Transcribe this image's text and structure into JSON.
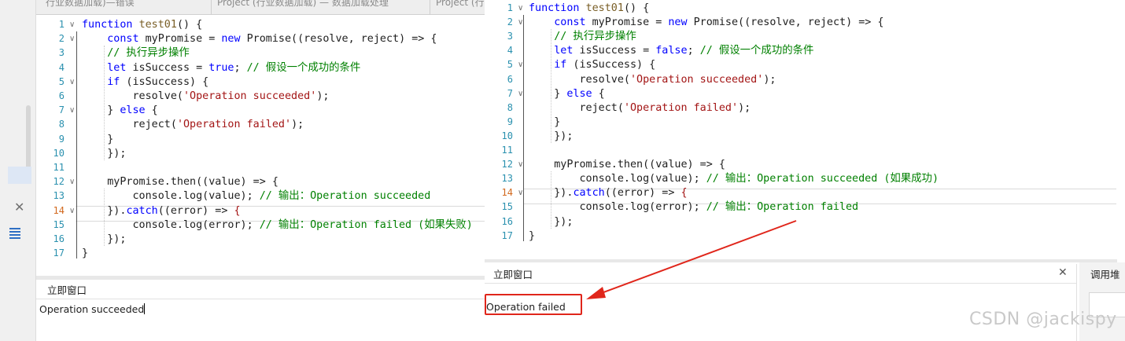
{
  "left_window": {
    "tabs": [
      "行业数据加载)—错误",
      "Project (行业数据加载) — 数据加载处理",
      "Project (行"
    ],
    "code_lines": [
      {
        "n": "1",
        "fold": "∨",
        "tokens": [
          {
            "t": "kw",
            "v": "function "
          },
          {
            "t": "fn",
            "v": "test01"
          },
          {
            "t": "plain",
            "v": "() {"
          }
        ]
      },
      {
        "n": "2",
        "fold": "∨",
        "tokens": [
          {
            "t": "plain",
            "v": "    "
          },
          {
            "t": "kw",
            "v": "const"
          },
          {
            "t": "plain",
            "v": " myPromise = "
          },
          {
            "t": "kw",
            "v": "new"
          },
          {
            "t": "plain",
            "v": " Promise((resolve, reject) => {"
          }
        ]
      },
      {
        "n": "3",
        "fold": "",
        "tokens": [
          {
            "t": "plain",
            "v": "    "
          },
          {
            "t": "cm",
            "v": "// 执行异步操作"
          }
        ]
      },
      {
        "n": "4",
        "fold": "",
        "tokens": [
          {
            "t": "plain",
            "v": "    "
          },
          {
            "t": "kw",
            "v": "let"
          },
          {
            "t": "plain",
            "v": " isSuccess = "
          },
          {
            "t": "kw",
            "v": "true"
          },
          {
            "t": "plain",
            "v": "; "
          },
          {
            "t": "cm",
            "v": "// 假设一个成功的条件"
          }
        ]
      },
      {
        "n": "5",
        "fold": "∨",
        "tokens": [
          {
            "t": "plain",
            "v": "    "
          },
          {
            "t": "kw",
            "v": "if"
          },
          {
            "t": "plain",
            "v": " (isSuccess) {"
          }
        ]
      },
      {
        "n": "6",
        "fold": "",
        "tokens": [
          {
            "t": "plain",
            "v": "        resolve("
          },
          {
            "t": "str",
            "v": "'Operation succeeded'"
          },
          {
            "t": "plain",
            "v": ");"
          }
        ]
      },
      {
        "n": "7",
        "fold": "∨",
        "tokens": [
          {
            "t": "plain",
            "v": "    } "
          },
          {
            "t": "kw",
            "v": "else"
          },
          {
            "t": "plain",
            "v": " {"
          }
        ]
      },
      {
        "n": "8",
        "fold": "",
        "tokens": [
          {
            "t": "plain",
            "v": "        reject("
          },
          {
            "t": "str",
            "v": "'Operation failed'"
          },
          {
            "t": "plain",
            "v": ");"
          }
        ]
      },
      {
        "n": "9",
        "fold": "",
        "tokens": [
          {
            "t": "plain",
            "v": "    }"
          }
        ]
      },
      {
        "n": "10",
        "fold": "",
        "tokens": [
          {
            "t": "plain",
            "v": "    });"
          }
        ]
      },
      {
        "n": "11",
        "fold": "",
        "tokens": []
      },
      {
        "n": "12",
        "fold": "∨",
        "tokens": [
          {
            "t": "plain",
            "v": "    myPromise.then((value) => {"
          }
        ]
      },
      {
        "n": "13",
        "fold": "",
        "tokens": [
          {
            "t": "plain",
            "v": "        console.log(value); "
          },
          {
            "t": "cm",
            "v": "// 输出：Operation succeeded"
          }
        ]
      },
      {
        "n": "14",
        "fold": "∨",
        "tokens": [
          {
            "t": "plain",
            "v": "    })."
          },
          {
            "t": "kw",
            "v": "catch"
          },
          {
            "t": "plain",
            "v": "((error) => "
          },
          {
            "t": "str",
            "v": "{"
          }
        ]
      },
      {
        "n": "15",
        "fold": "",
        "tokens": [
          {
            "t": "plain",
            "v": "        console.log(error); "
          },
          {
            "t": "cm",
            "v": "// 输出：Operation failed (如果失败)"
          }
        ]
      },
      {
        "n": "16",
        "fold": "",
        "tokens": [
          {
            "t": "plain",
            "v": "    });"
          }
        ]
      },
      {
        "n": "17",
        "fold": "",
        "tokens": [
          {
            "t": "plain",
            "v": "}"
          }
        ]
      }
    ],
    "immediate_title": "立即窗口",
    "output": "Operation succeeded"
  },
  "right_window": {
    "code_lines": [
      {
        "n": "1",
        "fold": "∨",
        "tokens": [
          {
            "t": "kw",
            "v": "function "
          },
          {
            "t": "fn",
            "v": "test01"
          },
          {
            "t": "plain",
            "v": "() {"
          }
        ]
      },
      {
        "n": "2",
        "fold": "∨",
        "tokens": [
          {
            "t": "plain",
            "v": "    "
          },
          {
            "t": "kw",
            "v": "const"
          },
          {
            "t": "plain",
            "v": " myPromise = "
          },
          {
            "t": "kw",
            "v": "new"
          },
          {
            "t": "plain",
            "v": " Promise((resolve, reject) => {"
          }
        ]
      },
      {
        "n": "3",
        "fold": "",
        "tokens": [
          {
            "t": "plain",
            "v": "    "
          },
          {
            "t": "cm",
            "v": "// 执行异步操作"
          }
        ]
      },
      {
        "n": "4",
        "fold": "",
        "tokens": [
          {
            "t": "plain",
            "v": "    "
          },
          {
            "t": "kw",
            "v": "let"
          },
          {
            "t": "plain",
            "v": " isSuccess = "
          },
          {
            "t": "kw",
            "v": "false"
          },
          {
            "t": "plain",
            "v": "; "
          },
          {
            "t": "cm",
            "v": "// 假设一个成功的条件"
          }
        ]
      },
      {
        "n": "5",
        "fold": "∨",
        "tokens": [
          {
            "t": "plain",
            "v": "    "
          },
          {
            "t": "kw",
            "v": "if"
          },
          {
            "t": "plain",
            "v": " (isSuccess) {"
          }
        ]
      },
      {
        "n": "6",
        "fold": "",
        "tokens": [
          {
            "t": "plain",
            "v": "        resolve("
          },
          {
            "t": "str",
            "v": "'Operation succeeded'"
          },
          {
            "t": "plain",
            "v": ");"
          }
        ]
      },
      {
        "n": "7",
        "fold": "∨",
        "tokens": [
          {
            "t": "plain",
            "v": "    } "
          },
          {
            "t": "kw",
            "v": "else"
          },
          {
            "t": "plain",
            "v": " {"
          }
        ]
      },
      {
        "n": "8",
        "fold": "",
        "tokens": [
          {
            "t": "plain",
            "v": "        reject("
          },
          {
            "t": "str",
            "v": "'Operation failed'"
          },
          {
            "t": "plain",
            "v": ");"
          }
        ]
      },
      {
        "n": "9",
        "fold": "",
        "tokens": [
          {
            "t": "plain",
            "v": "    }"
          }
        ]
      },
      {
        "n": "10",
        "fold": "",
        "tokens": [
          {
            "t": "plain",
            "v": "    });"
          }
        ]
      },
      {
        "n": "11",
        "fold": "",
        "tokens": []
      },
      {
        "n": "12",
        "fold": "∨",
        "tokens": [
          {
            "t": "plain",
            "v": "    myPromise.then((value) => {"
          }
        ]
      },
      {
        "n": "13",
        "fold": "",
        "tokens": [
          {
            "t": "plain",
            "v": "        console.log(value); "
          },
          {
            "t": "cm",
            "v": "// 输出：Operation succeeded (如果成功)"
          }
        ]
      },
      {
        "n": "14",
        "fold": "∨",
        "tokens": [
          {
            "t": "plain",
            "v": "    })."
          },
          {
            "t": "kw",
            "v": "catch"
          },
          {
            "t": "plain",
            "v": "((error) => "
          },
          {
            "t": "str",
            "v": "{"
          }
        ]
      },
      {
        "n": "15",
        "fold": "",
        "tokens": [
          {
            "t": "plain",
            "v": "        console.log(error); "
          },
          {
            "t": "cm",
            "v": "// 输出：Operation failed"
          }
        ]
      },
      {
        "n": "16",
        "fold": "",
        "tokens": [
          {
            "t": "plain",
            "v": "    });"
          }
        ]
      },
      {
        "n": "17",
        "fold": "",
        "tokens": [
          {
            "t": "plain",
            "v": "}"
          }
        ]
      }
    ],
    "immediate_title": "立即窗口",
    "close_glyph": "✕",
    "output": "Operation failed",
    "call_stack_title": "调用堆"
  },
  "watermark": "CSDN @jackispy",
  "colors": {
    "keyword": "#0000ff",
    "string": "#a31515",
    "comment": "#008000",
    "callout": "#e0261b"
  }
}
